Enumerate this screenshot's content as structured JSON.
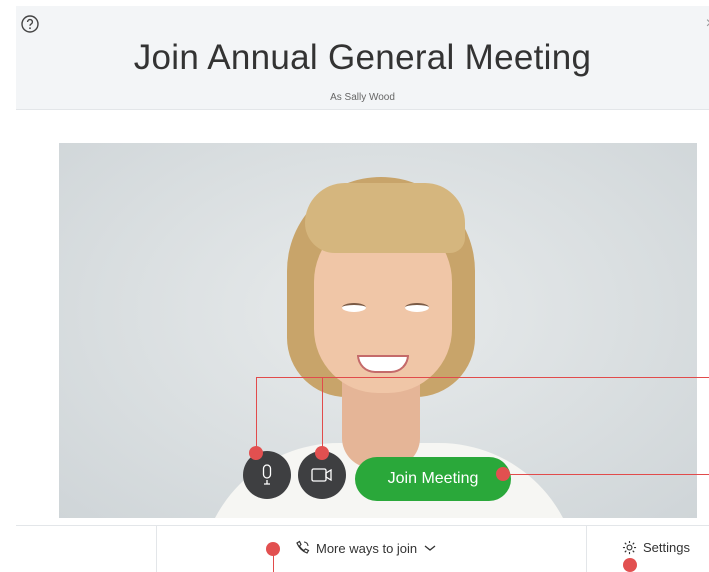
{
  "header": {
    "title": "Join Annual General Meeting",
    "subtitle": "As Sally Wood"
  },
  "controls": {
    "join_label": "Join Meeting"
  },
  "footer": {
    "more_ways_label": "More ways to join",
    "settings_label": "Settings"
  },
  "icons": {
    "help": "help-icon",
    "close": "close-icon",
    "mic": "microphone-icon",
    "camera": "video-camera-icon",
    "phone": "phone-call-icon",
    "chevron": "chevron-down-icon",
    "gear": "gear-icon"
  },
  "colors": {
    "join_green": "#2aa83a",
    "control_dark": "#3e3f41",
    "annotation_red": "#e14b4b"
  }
}
